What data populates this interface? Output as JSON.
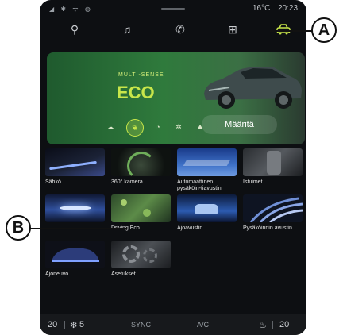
{
  "status_bar": {
    "signals": "◢ ✱ ᯤ ◍",
    "temperature": "16°C",
    "time": "20:23"
  },
  "top_nav": {
    "items": [
      {
        "icon": "location-pin-icon",
        "glyph": "⚲"
      },
      {
        "icon": "music-note-icon",
        "glyph": "♫"
      },
      {
        "icon": "phone-icon",
        "glyph": "✆"
      },
      {
        "icon": "apps-grid-icon",
        "glyph": "⊞"
      },
      {
        "icon": "car-icon",
        "glyph": "🚘",
        "active": true
      }
    ]
  },
  "hero": {
    "label": "MULTI-SENSE",
    "mode": "ECO",
    "mode_buttons": [
      {
        "icon": "cloud-icon",
        "glyph": "☁"
      },
      {
        "icon": "eco-leaf-icon",
        "glyph": "❦",
        "active": true
      },
      {
        "icon": "sport-gauge-icon",
        "glyph": "◔"
      },
      {
        "icon": "settings-gear-icon",
        "glyph": "✲"
      },
      {
        "icon": "mountain-icon",
        "glyph": "⛰"
      }
    ],
    "define_label": "Määritä"
  },
  "tiles": [
    {
      "label": "Sähkö",
      "name": "tile-sahko"
    },
    {
      "label": "360° kamera",
      "name": "tile-360-kamera"
    },
    {
      "label": "Automaattinen pysäköin-tiavustin",
      "name": "tile-automaattinen-pysakointiavustin"
    },
    {
      "label": "Istuimet",
      "name": "tile-istuimet"
    },
    {
      "label": "",
      "name": "tile-lights"
    },
    {
      "label": "Driving Eco",
      "name": "tile-driving-eco"
    },
    {
      "label": "Ajoavustin",
      "name": "tile-ajoavustin"
    },
    {
      "label": "Pysäköinnin avustin",
      "name": "tile-pysakoinnin-avustin"
    },
    {
      "label": "Ajoneuvo",
      "name": "tile-ajoneuvo"
    },
    {
      "label": "Asetukset",
      "name": "tile-asetukset"
    }
  ],
  "bottom_bar": {
    "left_temp": "20",
    "fan_speed": "5",
    "sync": "SYNC",
    "ac": "A/C",
    "right_temp": "20"
  },
  "callouts": {
    "a": "A",
    "b": "B"
  },
  "colors": {
    "accent": "#c8e64a",
    "background": "#0d0f12",
    "hero": "#2f7a3c"
  }
}
